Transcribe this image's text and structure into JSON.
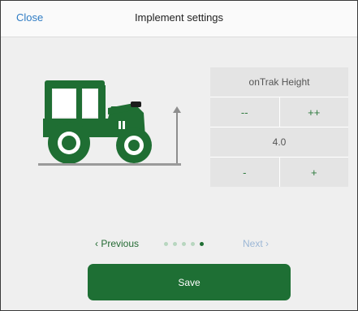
{
  "header": {
    "close_label": "Close",
    "title": "Implement settings"
  },
  "panel": {
    "title": "onTrak Height",
    "coarse_decrease_label": "--",
    "coarse_increase_label": "++",
    "value": "4.0",
    "fine_decrease_label": "-",
    "fine_increase_label": "+"
  },
  "pager": {
    "previous_label": "‹ Previous",
    "next_label": "Next ›",
    "page_count": 5,
    "current_page": 5
  },
  "save_label": "Save",
  "colors": {
    "brand_green": "#1e6f34",
    "link_blue": "#2f7cc4",
    "disabled_blue": "#9cb7d6",
    "background": "#efefef"
  },
  "icons": {
    "tractor": "tractor-icon",
    "height_arrow": "height-arrow-icon"
  }
}
